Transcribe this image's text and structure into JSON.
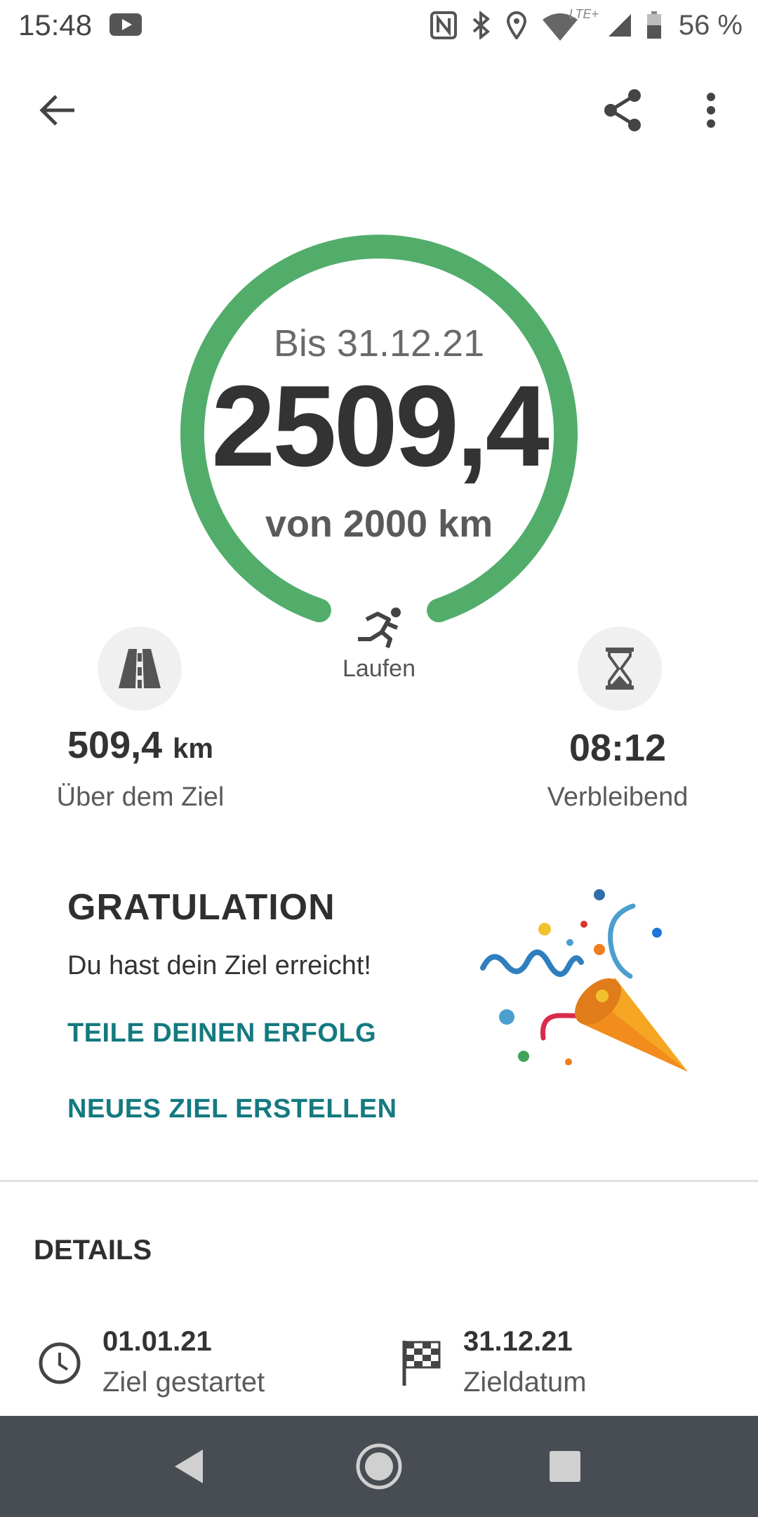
{
  "status_bar": {
    "time": "15:48",
    "network": "LTE+",
    "battery": "56 %",
    "icons": [
      "youtube-icon",
      "nfc-icon",
      "bluetooth-icon",
      "location-icon",
      "wifi-icon",
      "signal-icon",
      "battery-icon"
    ]
  },
  "toolbar": {
    "back_icon": "arrow-back-icon",
    "share_icon": "share-icon",
    "more_icon": "more-vert-icon"
  },
  "goal": {
    "date_line": "Bis 31.12.21",
    "value": "2509,4",
    "goal_line": "von 2000 km",
    "progress": 1.0,
    "ring_color": "#52ad6b"
  },
  "activity": {
    "icon": "running-icon",
    "label": "Laufen"
  },
  "stats": {
    "left": {
      "icon": "road-icon",
      "value": "509,4",
      "unit": "km",
      "label": "Über dem Ziel"
    },
    "right": {
      "icon": "hourglass-icon",
      "value": "08:12",
      "label": "Verbleibend"
    }
  },
  "congrats": {
    "title": "GRATULATION",
    "text": "Du hast dein Ziel erreicht!",
    "share_link": "TEILE DEINEN ERFOLG",
    "new_goal_link": "NEUES ZIEL ERSTELLEN",
    "image_icon": "party-popper-icon",
    "link_color": "#137a80"
  },
  "details": {
    "title": "DETAILS",
    "start": {
      "icon": "clock-icon",
      "value": "01.01.21",
      "label": "Ziel gestartet"
    },
    "end": {
      "icon": "checkered-flag-icon",
      "value": "31.12.21",
      "label": "Zieldatum"
    }
  },
  "nav_bar": {
    "back": "nav-back-icon",
    "home": "nav-home-icon",
    "recents": "nav-recents-icon"
  }
}
